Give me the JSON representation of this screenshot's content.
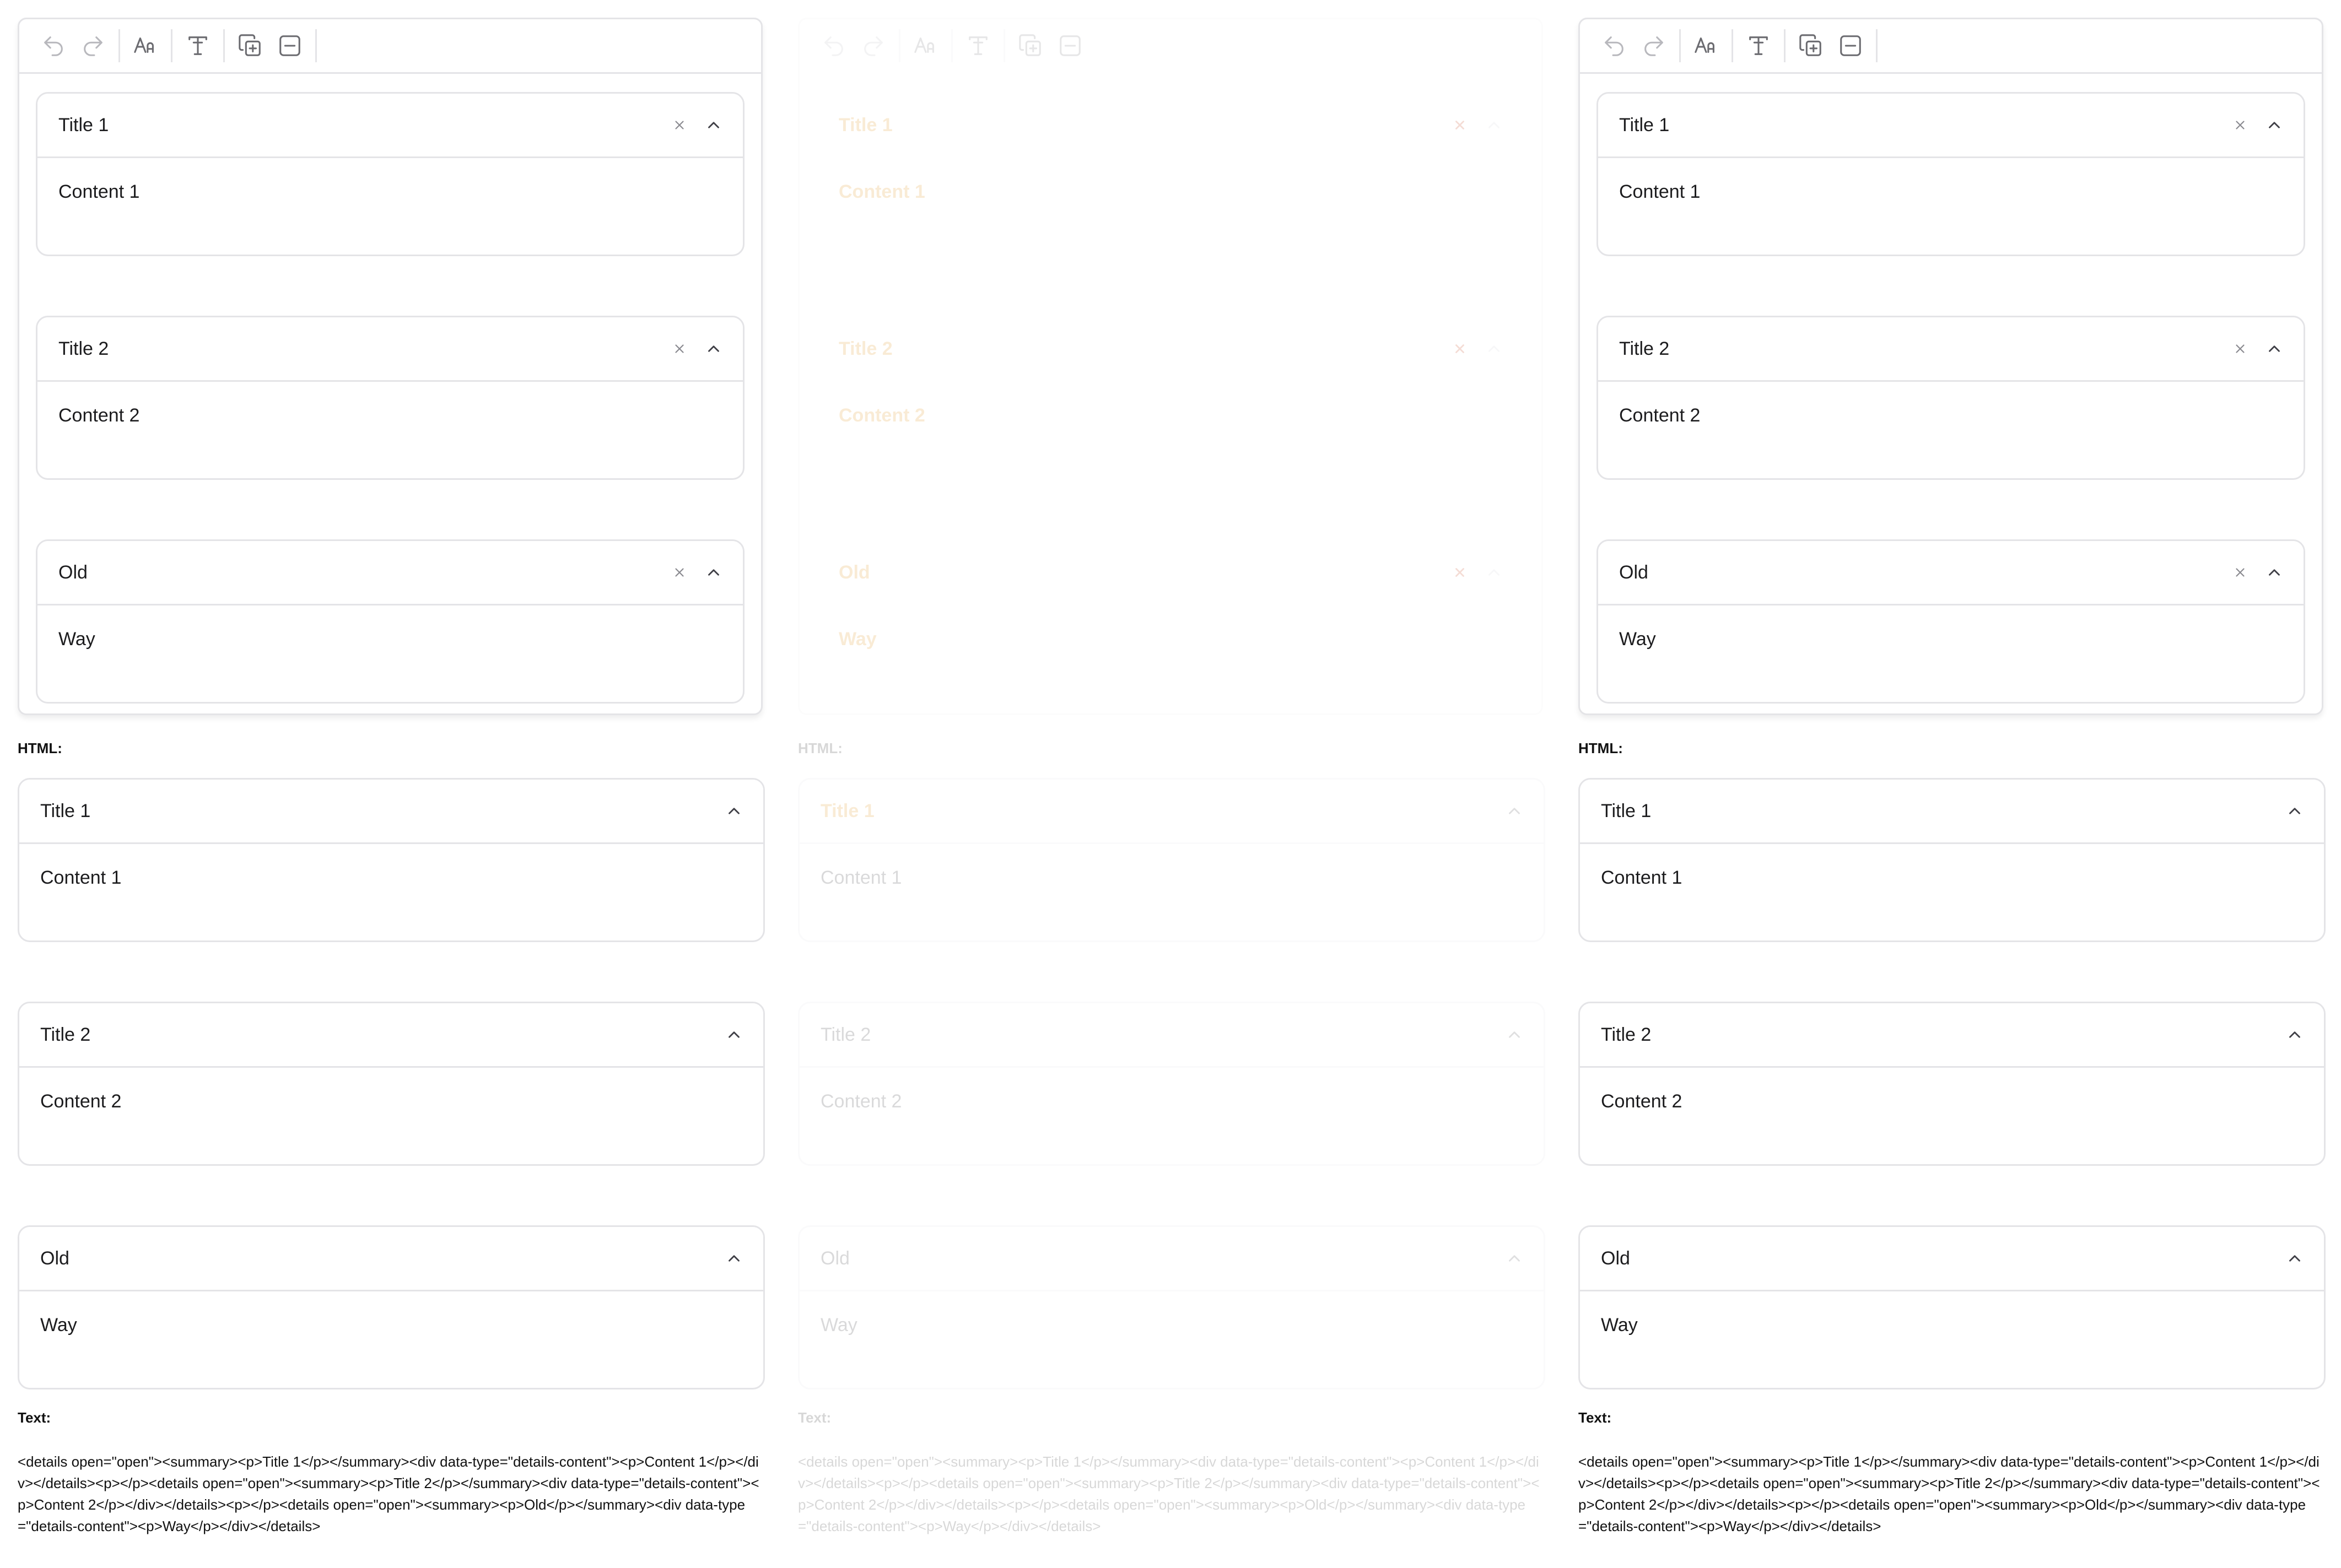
{
  "panels": [
    {
      "editor": {
        "items": [
          {
            "title": "Title 1",
            "content": "Content 1"
          },
          {
            "title": "Title 2",
            "content": "Content 2"
          },
          {
            "title": "Old",
            "content": "Way"
          }
        ]
      },
      "html_label": "HTML:",
      "output": {
        "items": [
          {
            "title": "Title 1",
            "content": "Content 1"
          },
          {
            "title": "Title 2",
            "content": "Content 2"
          },
          {
            "title": "Old",
            "content": "Way"
          }
        ]
      },
      "text_label": "Text:",
      "text_value": "<details open=\"open\"><summary><p>Title 1</p></summary><div data-type=\"details-content\"><p>Content 1</p></div></details><p></p><details open=\"open\"><summary><p>Title 2</p></summary><div data-type=\"details-content\"><p>Content 2</p></div></details><p></p><details open=\"open\"><summary><p>Old</p></summary><div data-type=\"details-content\"><p>Way</p></div></details>"
    },
    {
      "editor": {
        "items": [
          {
            "title": "Title 1",
            "content": "Content 1"
          },
          {
            "title": "Title 2",
            "content": "Content 2"
          },
          {
            "title": "Old",
            "content": "Way"
          }
        ]
      },
      "html_label": "HTML:",
      "output": {
        "items": [
          {
            "title": "Title 1",
            "content": "Content 1"
          },
          {
            "title": "Title 2",
            "content": "Content 2"
          },
          {
            "title": "Old",
            "content": "Way"
          }
        ]
      },
      "text_label": "Text:",
      "text_value": "<details open=\"open\"><summary><p>Title 1</p></summary><div data-type=\"details-content\"><p>Content 1</p></div></details><p></p><details open=\"open\"><summary><p>Title 2</p></summary><div data-type=\"details-content\"><p>Content 2</p></div></details><p></p><details open=\"open\"><summary><p>Old</p></summary><div data-type=\"details-content\"><p>Way</p></div></details>"
    },
    {
      "editor": {
        "items": [
          {
            "title": "Title 1",
            "content": "Content 1"
          },
          {
            "title": "Title 2",
            "content": "Content 2"
          },
          {
            "title": "Old",
            "content": "Way"
          }
        ]
      },
      "html_label": "HTML:",
      "output": {
        "items": [
          {
            "title": "Title 1",
            "content": "Content 1"
          },
          {
            "title": "Title 2",
            "content": "Content 2"
          },
          {
            "title": "Old",
            "content": "Way"
          }
        ]
      },
      "text_label": "Text:",
      "text_value": "<details open=\"open\"><summary><p>Title 1</p></summary><div data-type=\"details-content\"><p>Content 1</p></div></details><p></p><details open=\"open\"><summary><p>Title 2</p></summary><div data-type=\"details-content\"><p>Content 2</p></div></details><p></p><details open=\"open\"><summary><p>Old</p></summary><div data-type=\"details-content\"><p>Way</p></div></details>"
    }
  ],
  "toolbar_icons": [
    "undo-icon",
    "redo-icon",
    "text-size-icon",
    "text-format-icon",
    "add-block-icon",
    "remove-block-icon"
  ],
  "colors": {
    "border": "#e4e4e7",
    "text": "#1c1c1e",
    "ghost_accent": "#e08a00"
  }
}
